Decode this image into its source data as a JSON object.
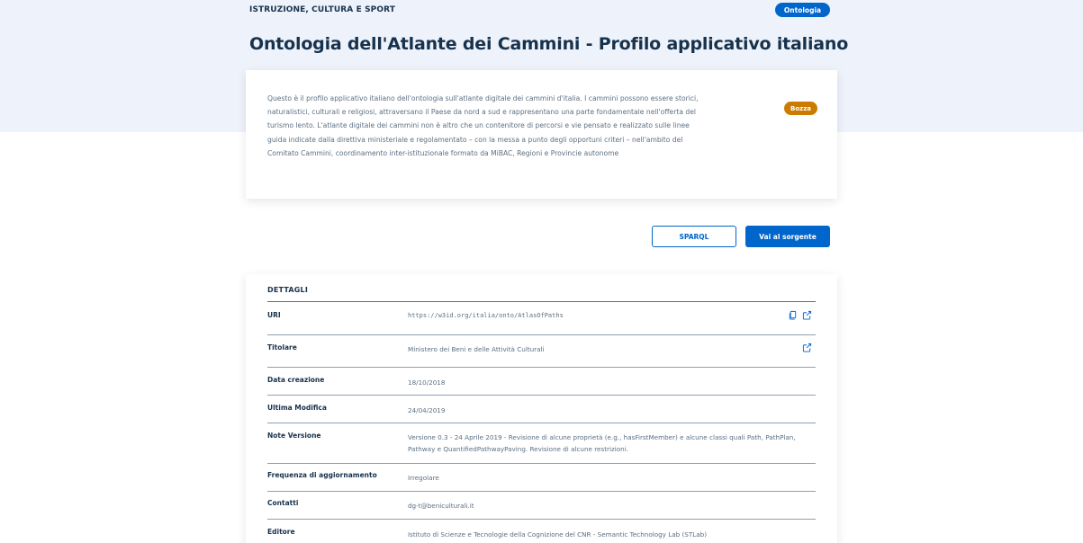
{
  "header": {
    "category": "ISTRUZIONE, CULTURA E SPORT",
    "type_badge": "Ontologia",
    "title": "Ontologia dell'Atlante dei Cammini - Profilo applicativo italiano"
  },
  "description": {
    "text": "Questo è il profilo applicativo italiano dell'ontologia sull'atlante digitale dei cammini d'italia. I cammini possono essere storici, naturalistici, culturali e religiosi, attraversano il Paese da nord a sud e rappresentano una parte fondamentale nell'offerta del turismo lento. L'atlante digitale dei cammini non è altro che un contenitore di percorsi e vie pensato e realizzato sulle linee guida indicate dalla direttiva ministeriale e regolamentato – con la messa a punto degli opportuni criteri – nell'ambito del Comitato Cammini, coordinamento inter-istituzionale formato da MiBAC, Regioni e Provincie autonome",
    "status_badge": "Bozza"
  },
  "actions": {
    "sparql_label": "SPARQL",
    "source_label": "Vai al sorgente"
  },
  "details": {
    "title": "DETTAGLI",
    "rows": [
      {
        "label": "URI",
        "value": "https://w3id.org/italia/onto/AtlasOfPaths"
      },
      {
        "label": "Titolare",
        "value": "Ministero dei Beni e delle Attività Culturali"
      },
      {
        "label": "Data creazione",
        "value": "18/10/2018"
      },
      {
        "label": "Ultima Modifica",
        "value": "24/04/2019"
      },
      {
        "label": "Note Versione",
        "value": "Versione 0.3 - 24 Aprile 2019 - Revisione di alcune proprietà (e.g., hasFirstMember) e alcune classi quali Path, PathPlan, Pathway e QuantifiedPathwayPaving. Revisione di alcune restrizioni."
      },
      {
        "label": "Frequenza di aggiornamento",
        "value": "Irregolare"
      },
      {
        "label": "Contatti",
        "value": "dg-t@beniculturali.it"
      },
      {
        "label": "Editore",
        "value": "Istituto di Scienze e Tecnologie della Cognizione del CNR - Semantic Technology Lab (STLab)"
      }
    ]
  },
  "colors": {
    "primary": "#0066cc",
    "hero_background": "#eef2fa",
    "draft_badge": "#cc7a00",
    "text_dark": "#17324d",
    "text_muted": "#5c6f82"
  },
  "icons": {
    "copy": "copy-icon",
    "external_link": "external-link-icon"
  }
}
